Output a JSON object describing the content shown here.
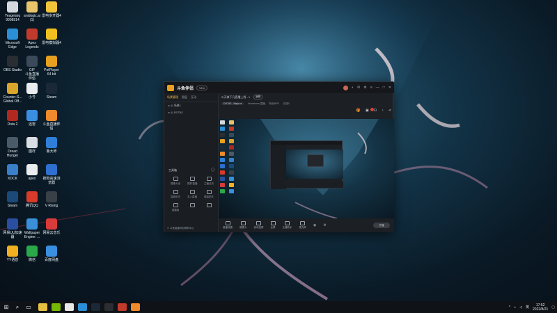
{
  "desktop": {
    "icons": [
      {
        "label": "Yeagelarq\n9998914",
        "icon": "user-card-icon",
        "color": "#d5d9de"
      },
      {
        "label": "anidogic.ai\n(1)",
        "icon": "folder-icon",
        "color": "#e8c46b"
      },
      {
        "label": "雷电多开器4",
        "icon": "ld-emulator-icon",
        "color": "#f2c43a"
      },
      {
        "label": "Microsoft\nEdge",
        "icon": "edge-icon",
        "color": "#2a8fd6"
      },
      {
        "label": "Apex\nLegends",
        "icon": "apex-icon",
        "color": "#c23a2c"
      },
      {
        "label": "雷电模拟器4",
        "icon": "ld-player-icon",
        "color": "#f0c020"
      },
      {
        "label": "OBS Studio",
        "icon": "obs-icon",
        "color": "#2a2e33"
      },
      {
        "label": "GIF\n斗鱼直播\n伴侣",
        "icon": "video-file-icon",
        "color": "#3a4a5a"
      },
      {
        "label": "PotPlayer\n64 bit",
        "icon": "potplayer-icon",
        "color": "#e8a020"
      },
      {
        "label": "Counter-S...\nGlobal Off...",
        "icon": "csgo-icon",
        "color": "#d9a52a"
      },
      {
        "label": "小号",
        "icon": "text-file-icon",
        "color": "#e9edf0"
      },
      {
        "label": "Steam",
        "icon": "steam-icon",
        "color": "#1b2838"
      },
      {
        "label": "Dota 2",
        "icon": "dota-icon",
        "color": "#b0281f"
      },
      {
        "label": "迅雷",
        "icon": "thunder-icon",
        "color": "#3a8fe0"
      },
      {
        "label": "斗鱼直播伴\n侣",
        "icon": "douyu-icon",
        "color": "#f08a2a"
      },
      {
        "label": "Dread\nHunger",
        "icon": "anchor-icon",
        "color": "#4a5a66"
      },
      {
        "label": "图样",
        "icon": "image-file-icon",
        "color": "#d9dee2"
      },
      {
        "label": "鲁大师",
        "icon": "ludashi-icon",
        "color": "#2f7fd9"
      },
      {
        "label": "XDCK",
        "icon": "xdck-icon",
        "color": "#3a7fc9"
      },
      {
        "label": "apex",
        "icon": "document-icon",
        "color": "#e9edf0"
      },
      {
        "label": "搜狗高速浏\n览器",
        "icon": "sogou-icon",
        "color": "#2f6fd0"
      },
      {
        "label": "Steam",
        "icon": "steam-shortcut-icon",
        "color": "#1b4a78"
      },
      {
        "label": "腾讯QQ",
        "icon": "qq-icon",
        "color": "#d93a2a"
      },
      {
        "label": "V Rising",
        "icon": "vrising-icon",
        "color": "#3a4048"
      },
      {
        "label": "网易UU加速\n器",
        "icon": "uu-icon",
        "color": "#2a4fa0"
      },
      {
        "label": "Wallpaper\nEngine: ...",
        "icon": "wallpaper-engine-icon",
        "color": "#3a8fd9"
      },
      {
        "label": "网易云音乐",
        "icon": "netease-music-icon",
        "color": "#d93a3a"
      },
      {
        "label": "YY语音",
        "icon": "yy-icon",
        "color": "#f0b020"
      },
      {
        "label": "微信",
        "icon": "wechat-icon",
        "color": "#2aa84a"
      },
      {
        "label": "百度网盘",
        "icon": "baidu-netdisk-icon",
        "color": "#3a8fe0"
      }
    ]
  },
  "app": {
    "brand": "斗鱼伴侣",
    "version": "V5 ▾",
    "left_tabs": [
      "场景管理",
      "图层",
      "互动"
    ],
    "scenes": [
      "▸ ◎  场景1",
      "▸ ◎  DOTA2"
    ],
    "tools_title": "工具箱",
    "tools": [
      "摄像头设",
      "录屏/直播",
      "主播日历",
      "智能助手",
      "本人直播",
      "弹幕助手",
      "直播画",
      "",
      ""
    ],
    "left_footer": "⊙ 斗鱼直播伴侣帮助中心",
    "room_title": "2!天神下凡直播上线 - 1",
    "room_chip": "编辑",
    "category_chip": "DOTA2 - Major ▾",
    "sub_stats": [
      "Hometown 直播",
      "粉丝NFR",
      "在线0"
    ],
    "bottom_items": [
      "直播设置",
      "摄像头",
      "游戏投屏",
      "全屏",
      "主播助手",
      "麦克风"
    ],
    "go_live": "开播"
  },
  "taskbar": {
    "clock_time": "17:52",
    "clock_date": "2022/8/21",
    "apps": [
      {
        "icon": "explorer-icon",
        "color": "#e8c040"
      },
      {
        "icon": "nvidia-icon",
        "color": "#76b900"
      },
      {
        "icon": "music-icon",
        "color": "#e8e8e8"
      },
      {
        "icon": "edge-icon",
        "color": "#2a8fd6"
      },
      {
        "icon": "steam-icon",
        "color": "#1b2838"
      },
      {
        "icon": "obs-icon",
        "color": "#2a2e33"
      },
      {
        "icon": "apex-icon",
        "color": "#c23a2c"
      },
      {
        "icon": "douyu-icon",
        "color": "#f08a2a"
      }
    ]
  }
}
